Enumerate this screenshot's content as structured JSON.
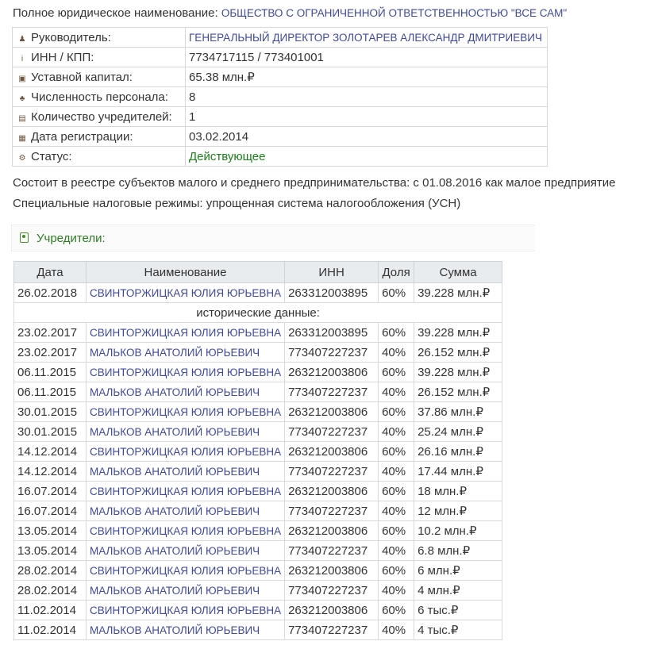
{
  "full_name": {
    "label": "Полное юридическое наименование:",
    "value": "ОБЩЕСТВО С ОГРАНИЧЕННОЙ ОТВЕТСТВЕННОСТЬЮ \"ВСЕ САМ\""
  },
  "info_rows": [
    {
      "icon": "person-icon",
      "glyph": "♟",
      "label": "Руководитель:",
      "value": "ГЕНЕРАЛЬНЫЙ ДИРЕКТОР ЗОЛОТАРЕВ АЛЕКСАНДР ДМИТРИЕВИЧ",
      "is_link": true
    },
    {
      "icon": "info-icon",
      "glyph": "i",
      "label": "ИНН / КПП:",
      "value": "7734717115 / 773401001"
    },
    {
      "icon": "money-icon",
      "glyph": "▣",
      "label": "Уставной капитал:",
      "value": "65.38 млн.₽"
    },
    {
      "icon": "group-icon",
      "glyph": "♣",
      "label": "Численность персонала:",
      "value": "8"
    },
    {
      "icon": "founder-book-icon",
      "glyph": "▤",
      "label": "Количество учредителей:",
      "value": "1"
    },
    {
      "icon": "calendar-icon",
      "glyph": "▦",
      "label": "Дата регистрации:",
      "value": "03.02.2014"
    },
    {
      "icon": "gears-icon",
      "glyph": "⚙",
      "label": "Статус:",
      "value": "Действующее",
      "status_color": "#1e7d1e"
    }
  ],
  "sme_line": "Состоит в реестре субъектов малого и среднего предпринимательства: с 01.08.2016 как малое предприятие",
  "tax_line": "Специальные налоговые режимы: упрощенная система налогообложения (УСН)",
  "founders_panel": {
    "title": "Учредители:",
    "icon": "contact-book-icon"
  },
  "founders_table": {
    "headers": [
      "Дата",
      "Наименование",
      "ИНН",
      "Доля",
      "Сумма"
    ],
    "current": {
      "date": "26.02.2018",
      "name": "СВИНТОРЖИЦКАЯ ЮЛИЯ ЮРЬЕВНА",
      "inn": "263312003895",
      "share": "60%",
      "sum": "39.228 млн.₽"
    },
    "history_label": "исторические данные:",
    "history": [
      {
        "date": "23.02.2017",
        "name": "СВИНТОРЖИЦКАЯ ЮЛИЯ ЮРЬЕВНА",
        "inn": "263312003895",
        "share": "60%",
        "sum": "39.228 млн.₽"
      },
      {
        "date": "23.02.2017",
        "name": "МАЛЬКОВ АНАТОЛИЙ ЮРЬЕВИЧ",
        "inn": "773407227237",
        "share": "40%",
        "sum": "26.152 млн.₽"
      },
      {
        "date": "06.11.2015",
        "name": "СВИНТОРЖИЦКАЯ ЮЛИЯ ЮРЬЕВНА",
        "inn": "263212003806",
        "share": "60%",
        "sum": "39.228 млн.₽"
      },
      {
        "date": "06.11.2015",
        "name": "МАЛЬКОВ АНАТОЛИЙ ЮРЬЕВИЧ",
        "inn": "773407227237",
        "share": "40%",
        "sum": "26.152 млн.₽"
      },
      {
        "date": "30.01.2015",
        "name": "СВИНТОРЖИЦКАЯ ЮЛИЯ ЮРЬЕВНА",
        "inn": "263212003806",
        "share": "60%",
        "sum": "37.86 млн.₽"
      },
      {
        "date": "30.01.2015",
        "name": "МАЛЬКОВ АНАТОЛИЙ ЮРЬЕВИЧ",
        "inn": "773407227237",
        "share": "40%",
        "sum": "25.24 млн.₽"
      },
      {
        "date": "14.12.2014",
        "name": "СВИНТОРЖИЦКАЯ ЮЛИЯ ЮРЬЕВНА",
        "inn": "263212003806",
        "share": "60%",
        "sum": "26.16 млн.₽"
      },
      {
        "date": "14.12.2014",
        "name": "МАЛЬКОВ АНАТОЛИЙ ЮРЬЕВИЧ",
        "inn": "773407227237",
        "share": "40%",
        "sum": "17.44 млн.₽"
      },
      {
        "date": "16.07.2014",
        "name": "СВИНТОРЖИЦКАЯ ЮЛИЯ ЮРЬЕВНА",
        "inn": "263212003806",
        "share": "60%",
        "sum": "18 млн.₽"
      },
      {
        "date": "16.07.2014",
        "name": "МАЛЬКОВ АНАТОЛИЙ ЮРЬЕВИЧ",
        "inn": "773407227237",
        "share": "40%",
        "sum": "12 млн.₽"
      },
      {
        "date": "13.05.2014",
        "name": "СВИНТОРЖИЦКАЯ ЮЛИЯ ЮРЬЕВНА",
        "inn": "263212003806",
        "share": "60%",
        "sum": "10.2 млн.₽"
      },
      {
        "date": "13.05.2014",
        "name": "МАЛЬКОВ АНАТОЛИЙ ЮРЬЕВИЧ",
        "inn": "773407227237",
        "share": "40%",
        "sum": "6.8 млн.₽"
      },
      {
        "date": "28.02.2014",
        "name": "СВИНТОРЖИЦКАЯ ЮЛИЯ ЮРЬЕВНА",
        "inn": "263212003806",
        "share": "60%",
        "sum": "6 млн.₽"
      },
      {
        "date": "28.02.2014",
        "name": "МАЛЬКОВ АНАТОЛИЙ ЮРЬЕВИЧ",
        "inn": "773407227237",
        "share": "40%",
        "sum": "4 млн.₽"
      },
      {
        "date": "11.02.2014",
        "name": "СВИНТОРЖИЦКАЯ ЮЛИЯ ЮРЬЕВНА",
        "inn": "263212003806",
        "share": "60%",
        "sum": "6 тыс.₽"
      },
      {
        "date": "11.02.2014",
        "name": "МАЛЬКОВ АНАТОЛИЙ ЮРЬЕВИЧ",
        "inn": "773407227237",
        "share": "40%",
        "sum": "4 тыс.₽"
      }
    ]
  }
}
